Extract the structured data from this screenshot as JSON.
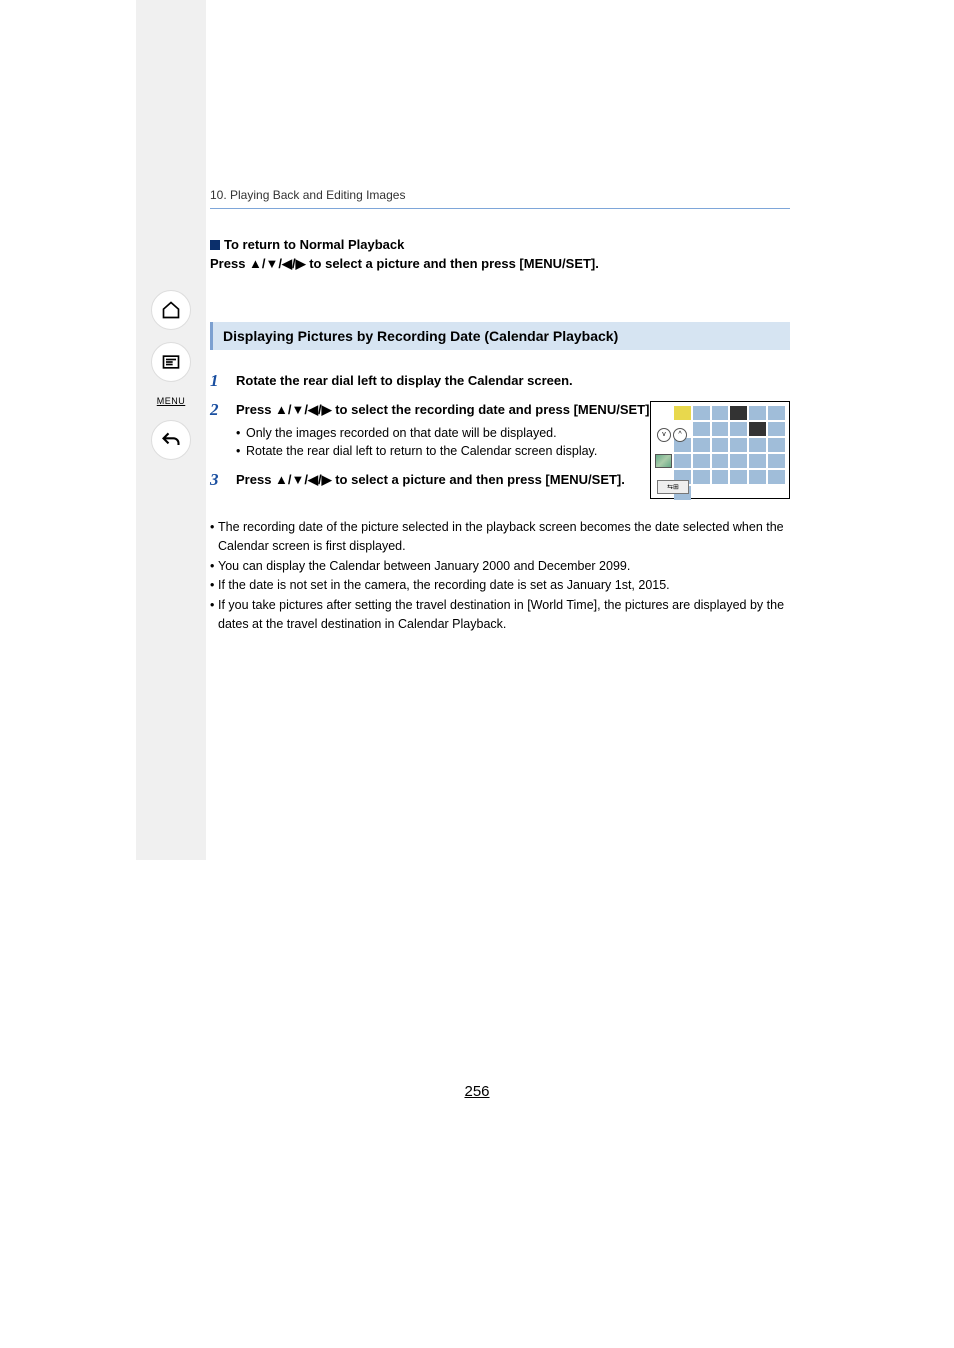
{
  "breadcrumb": "10. Playing Back and Editing Images",
  "sidebar": {
    "menu_label": "MENU"
  },
  "block1": {
    "title": "To return to Normal Playback",
    "instruction": "Press ▲/▼/◀/▶ to select a picture and then press [MENU/SET]."
  },
  "section_title": "Displaying Pictures by Recording Date (Calendar Playback)",
  "steps": [
    {
      "n": "1",
      "main": "Rotate the rear dial left to display the Calendar screen."
    },
    {
      "n": "2",
      "main": "Press ▲/▼/◀/▶ to select the recording date and press [MENU/SET].",
      "subs": [
        "Only the images recorded on that date will be displayed.",
        "Rotate the rear dial left to return to the Calendar screen display."
      ]
    },
    {
      "n": "3",
      "main": "Press ▲/▼/◀/▶ to select a picture and then press [MENU/SET]."
    }
  ],
  "notes": [
    "The recording date of the picture selected in the playback screen becomes the date selected when the Calendar screen is first displayed.",
    "You can display the Calendar between January 2000 and December 2099.",
    "If the date is not set in the camera, the recording date is set as January 1st, 2015.",
    "If you take pictures after setting the travel destination in [World Time], the pictures are displayed by the dates at the travel destination in Calendar Playback."
  ],
  "page_number": "256"
}
